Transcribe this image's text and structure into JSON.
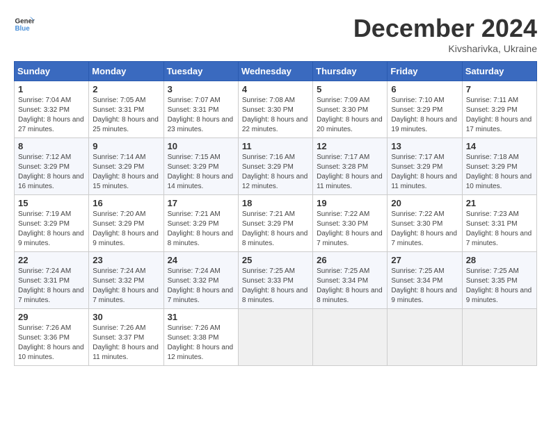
{
  "header": {
    "logo_general": "General",
    "logo_blue": "Blue",
    "month_title": "December 2024",
    "location": "Kivsharivka, Ukraine"
  },
  "days_of_week": [
    "Sunday",
    "Monday",
    "Tuesday",
    "Wednesday",
    "Thursday",
    "Friday",
    "Saturday"
  ],
  "weeks": [
    [
      {
        "day": 1,
        "sunrise": "7:04 AM",
        "sunset": "3:32 PM",
        "daylight": "8 hours and 27 minutes."
      },
      {
        "day": 2,
        "sunrise": "7:05 AM",
        "sunset": "3:31 PM",
        "daylight": "8 hours and 25 minutes."
      },
      {
        "day": 3,
        "sunrise": "7:07 AM",
        "sunset": "3:31 PM",
        "daylight": "8 hours and 23 minutes."
      },
      {
        "day": 4,
        "sunrise": "7:08 AM",
        "sunset": "3:30 PM",
        "daylight": "8 hours and 22 minutes."
      },
      {
        "day": 5,
        "sunrise": "7:09 AM",
        "sunset": "3:30 PM",
        "daylight": "8 hours and 20 minutes."
      },
      {
        "day": 6,
        "sunrise": "7:10 AM",
        "sunset": "3:29 PM",
        "daylight": "8 hours and 19 minutes."
      },
      {
        "day": 7,
        "sunrise": "7:11 AM",
        "sunset": "3:29 PM",
        "daylight": "8 hours and 17 minutes."
      }
    ],
    [
      {
        "day": 8,
        "sunrise": "7:12 AM",
        "sunset": "3:29 PM",
        "daylight": "8 hours and 16 minutes."
      },
      {
        "day": 9,
        "sunrise": "7:14 AM",
        "sunset": "3:29 PM",
        "daylight": "8 hours and 15 minutes."
      },
      {
        "day": 10,
        "sunrise": "7:15 AM",
        "sunset": "3:29 PM",
        "daylight": "8 hours and 14 minutes."
      },
      {
        "day": 11,
        "sunrise": "7:16 AM",
        "sunset": "3:29 PM",
        "daylight": "8 hours and 12 minutes."
      },
      {
        "day": 12,
        "sunrise": "7:17 AM",
        "sunset": "3:28 PM",
        "daylight": "8 hours and 11 minutes."
      },
      {
        "day": 13,
        "sunrise": "7:17 AM",
        "sunset": "3:29 PM",
        "daylight": "8 hours and 11 minutes."
      },
      {
        "day": 14,
        "sunrise": "7:18 AM",
        "sunset": "3:29 PM",
        "daylight": "8 hours and 10 minutes."
      }
    ],
    [
      {
        "day": 15,
        "sunrise": "7:19 AM",
        "sunset": "3:29 PM",
        "daylight": "8 hours and 9 minutes."
      },
      {
        "day": 16,
        "sunrise": "7:20 AM",
        "sunset": "3:29 PM",
        "daylight": "8 hours and 9 minutes."
      },
      {
        "day": 17,
        "sunrise": "7:21 AM",
        "sunset": "3:29 PM",
        "daylight": "8 hours and 8 minutes."
      },
      {
        "day": 18,
        "sunrise": "7:21 AM",
        "sunset": "3:29 PM",
        "daylight": "8 hours and 8 minutes."
      },
      {
        "day": 19,
        "sunrise": "7:22 AM",
        "sunset": "3:30 PM",
        "daylight": "8 hours and 7 minutes."
      },
      {
        "day": 20,
        "sunrise": "7:22 AM",
        "sunset": "3:30 PM",
        "daylight": "8 hours and 7 minutes."
      },
      {
        "day": 21,
        "sunrise": "7:23 AM",
        "sunset": "3:31 PM",
        "daylight": "8 hours and 7 minutes."
      }
    ],
    [
      {
        "day": 22,
        "sunrise": "7:24 AM",
        "sunset": "3:31 PM",
        "daylight": "8 hours and 7 minutes."
      },
      {
        "day": 23,
        "sunrise": "7:24 AM",
        "sunset": "3:32 PM",
        "daylight": "8 hours and 7 minutes."
      },
      {
        "day": 24,
        "sunrise": "7:24 AM",
        "sunset": "3:32 PM",
        "daylight": "8 hours and 7 minutes."
      },
      {
        "day": 25,
        "sunrise": "7:25 AM",
        "sunset": "3:33 PM",
        "daylight": "8 hours and 8 minutes."
      },
      {
        "day": 26,
        "sunrise": "7:25 AM",
        "sunset": "3:34 PM",
        "daylight": "8 hours and 8 minutes."
      },
      {
        "day": 27,
        "sunrise": "7:25 AM",
        "sunset": "3:34 PM",
        "daylight": "8 hours and 9 minutes."
      },
      {
        "day": 28,
        "sunrise": "7:25 AM",
        "sunset": "3:35 PM",
        "daylight": "8 hours and 9 minutes."
      }
    ],
    [
      {
        "day": 29,
        "sunrise": "7:26 AM",
        "sunset": "3:36 PM",
        "daylight": "8 hours and 10 minutes."
      },
      {
        "day": 30,
        "sunrise": "7:26 AM",
        "sunset": "3:37 PM",
        "daylight": "8 hours and 11 minutes."
      },
      {
        "day": 31,
        "sunrise": "7:26 AM",
        "sunset": "3:38 PM",
        "daylight": "8 hours and 12 minutes."
      },
      null,
      null,
      null,
      null
    ]
  ]
}
